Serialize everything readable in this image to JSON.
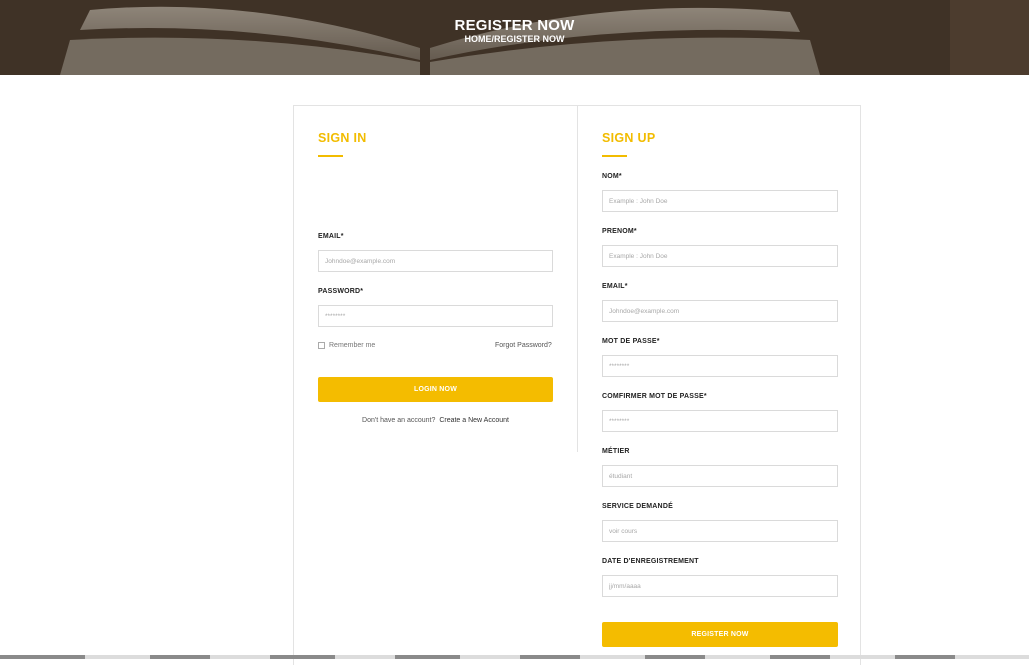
{
  "hero": {
    "title": "REGISTER NOW",
    "breadcrumb_home": "HOME",
    "breadcrumb_sep": "/",
    "breadcrumb_current": "REGISTER NOW"
  },
  "sign_in": {
    "title": "SIGN IN",
    "email_label": "EMAIL*",
    "email_placeholder": "Johndoe@example.com",
    "password_label": "PASSWORD*",
    "password_placeholder": "********",
    "remember_label": "Remember me",
    "forgot_label": "Forgot Password?",
    "login_button": "LOGIN NOW",
    "no_account_text": "Don't have an account?",
    "create_account_link": "Create a New Account"
  },
  "sign_up": {
    "title": "SIGN UP",
    "fields": [
      {
        "label": "NOM*",
        "placeholder": "Example : John Doe"
      },
      {
        "label": "PRENOM*",
        "placeholder": "Example : John Doe"
      },
      {
        "label": "EMAIL*",
        "placeholder": "Johndoe@example.com"
      },
      {
        "label": "MOT DE PASSE*",
        "placeholder": "********"
      },
      {
        "label": "COMFIRMER MOT DE PASSE*",
        "placeholder": "********"
      },
      {
        "label": "MÉTIER",
        "placeholder": "étudiant"
      },
      {
        "label": "SERVICE DEMANDÉ",
        "placeholder": "voir cours"
      },
      {
        "label": "DATE D'ENREGISTREMENT",
        "placeholder": "jj/mm/aaaa"
      }
    ],
    "register_button": "REGISTER NOW"
  },
  "colors": {
    "accent": "#f4bc00",
    "border": "#e3e3e3"
  }
}
